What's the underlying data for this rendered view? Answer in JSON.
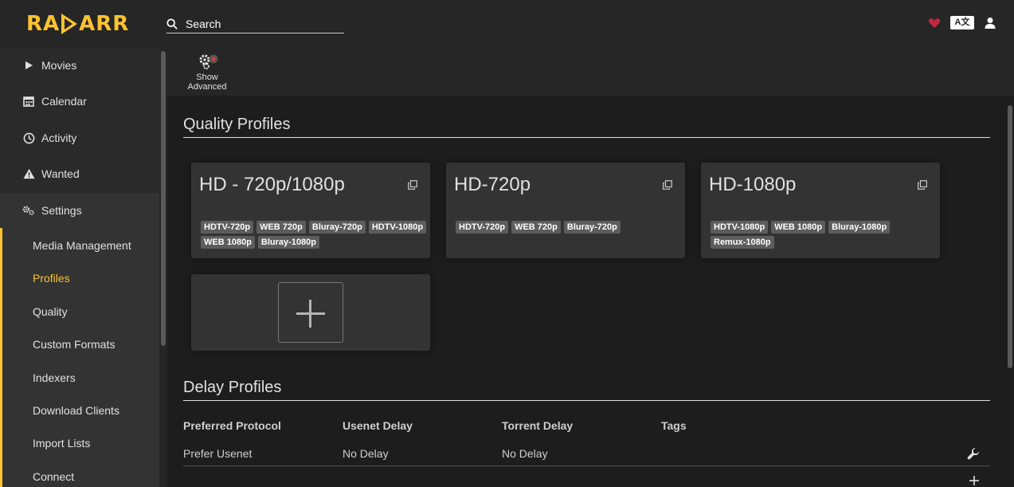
{
  "app": {
    "logo_text_left": "RA",
    "logo_text_right": "ARR",
    "accent_color": "#ffc230"
  },
  "header": {
    "search_placeholder": "Search",
    "icons": [
      "search-icon",
      "heart-icon",
      "translate-icon",
      "user-icon"
    ],
    "lang_label": "A文"
  },
  "sidebar": {
    "items": [
      {
        "label": "Movies",
        "icon": "play-icon"
      },
      {
        "label": "Calendar",
        "icon": "calendar-icon"
      },
      {
        "label": "Activity",
        "icon": "clock-icon"
      },
      {
        "label": "Wanted",
        "icon": "warning-icon"
      },
      {
        "label": "Settings",
        "icon": "gears-icon"
      }
    ],
    "settings_sub": [
      {
        "label": "Media Management"
      },
      {
        "label": "Profiles",
        "active": true
      },
      {
        "label": "Quality"
      },
      {
        "label": "Custom Formats"
      },
      {
        "label": "Indexers"
      },
      {
        "label": "Download Clients"
      },
      {
        "label": "Import Lists"
      },
      {
        "label": "Connect"
      }
    ]
  },
  "toolbar": {
    "show_advanced_line1": "Show",
    "show_advanced_line2": "Advanced"
  },
  "quality_profiles": {
    "title": "Quality Profiles",
    "profiles": [
      {
        "name": "HD - 720p/1080p",
        "qualities": [
          "HDTV-720p",
          "WEB 720p",
          "Bluray-720p",
          "HDTV-1080p",
          "WEB 1080p",
          "Bluray-1080p"
        ]
      },
      {
        "name": "HD-720p",
        "qualities": [
          "HDTV-720p",
          "WEB 720p",
          "Bluray-720p"
        ]
      },
      {
        "name": "HD-1080p",
        "qualities": [
          "HDTV-1080p",
          "WEB 1080p",
          "Bluray-1080p",
          "Remux-1080p"
        ]
      }
    ]
  },
  "delay_profiles": {
    "title": "Delay Profiles",
    "columns": [
      "Preferred Protocol",
      "Usenet Delay",
      "Torrent Delay",
      "Tags"
    ],
    "rows": [
      {
        "protocol": "Prefer Usenet",
        "usenet_delay": "No Delay",
        "torrent_delay": "No Delay",
        "tags": ""
      }
    ]
  }
}
